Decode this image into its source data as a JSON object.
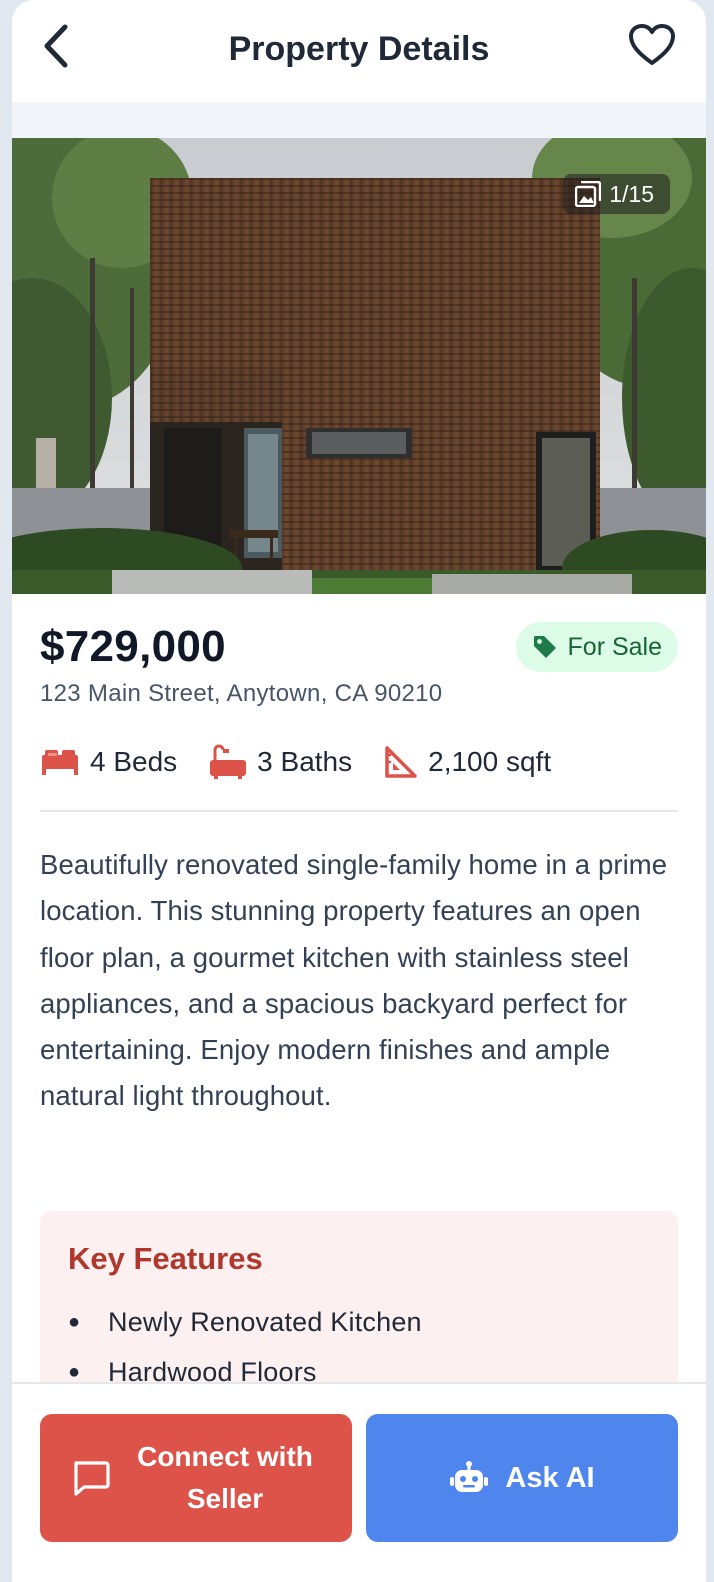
{
  "header": {
    "title": "Property Details"
  },
  "gallery": {
    "counter": "1/15"
  },
  "listing": {
    "price": "$729,000",
    "status": "For Sale",
    "address": "123 Main Street, Anytown, CA 90210",
    "beds": "4 Beds",
    "baths": "3 Baths",
    "area": "2,100 sqft",
    "description": "Beautifully renovated single-family home in a prime location. This stunning property features an open floor plan, a gourmet kitchen with stainless steel appliances, and a spacious backyard perfect for entertaining. Enjoy modern finishes and ample natural light throughout."
  },
  "features": {
    "title": "Key Features",
    "items": [
      "Newly Renovated Kitchen",
      "Hardwood Floors"
    ]
  },
  "actions": {
    "connect_label": "Connect with Seller",
    "ai_label": "Ask AI"
  },
  "icons": {
    "back": "chevron-left-icon",
    "favorite": "heart-outline-icon",
    "gallery": "image-stack-icon",
    "tag": "tag-icon",
    "bed": "bed-icon",
    "bath": "bathtub-icon",
    "area": "ruler-triangle-icon",
    "chat": "chat-bubble-icon",
    "robot": "robot-icon"
  },
  "colors": {
    "accent_red": "#dd5349",
    "accent_blue": "#4f86ed",
    "badge_bg": "#dcfce7",
    "badge_text": "#166534",
    "features_title": "#b1372c"
  }
}
